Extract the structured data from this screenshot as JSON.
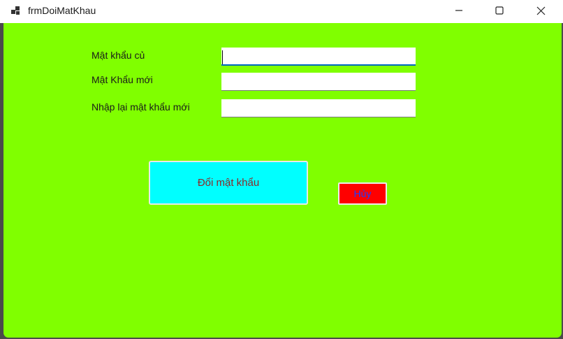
{
  "window": {
    "title": "frmDoiMatKhau",
    "icon": "app-window-icon",
    "client_color": "#80ff00"
  },
  "captions": {
    "minimize_icon": "minimize-icon",
    "maximize_icon": "maximize-icon",
    "close_icon": "close-icon"
  },
  "form": {
    "old_password_label": "Mật khẩu củ",
    "old_password_value": "",
    "new_password_label": "Mật Khẩu mới",
    "new_password_value": "",
    "confirm_password_label": "Nhập lại mật khẩu mới",
    "confirm_password_value": ""
  },
  "buttons": {
    "change_password_label": "Đổi mật khẩu",
    "change_password_color": "#00ffff",
    "cancel_label": "Hủy",
    "cancel_color": "#ff0000"
  }
}
